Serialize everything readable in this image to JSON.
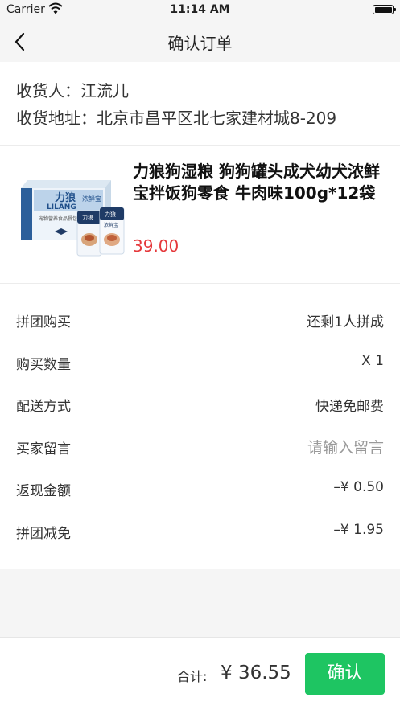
{
  "status_bar": {
    "carrier": "Carrier",
    "time": "11:14 AM"
  },
  "nav": {
    "title": "确认订单",
    "back_icon": "chevron-left-icon"
  },
  "address": {
    "receiver_label": "收货人：",
    "receiver_name": "江流儿",
    "address_label": "收货地址：",
    "address_value": "北京市昌平区北七家建材城8-209"
  },
  "product": {
    "name": "力狼狗湿粮 狗狗罐头成犬幼犬浓鲜宝拌饭狗零食 牛肉味100g*12袋",
    "price": "39.00",
    "image_box_brand": "力狼",
    "image_box_brand_en": "LILANG",
    "image_box_sub": "浓鲜宝",
    "image_box_line": "宠物营养食品餐包",
    "image_pouch_brand": "力狼",
    "image_pouch_sub": "浓鲜宝"
  },
  "rows": [
    {
      "label": "拼团购买",
      "value": "还剩1人拼成"
    },
    {
      "label": "购买数量",
      "value": "X 1"
    },
    {
      "label": "配送方式",
      "value": "快递免邮费"
    },
    {
      "label": "买家留言",
      "placeholder": "请输入留言"
    },
    {
      "label": "返现金额",
      "value": "–¥ 0.50"
    },
    {
      "label": "拼团减免",
      "value": "–¥ 1.95"
    }
  ],
  "bottom": {
    "total_label": "合计:",
    "total_value": "¥ 36.55",
    "confirm_label": "确认"
  },
  "colors": {
    "accent_green": "#1ec562",
    "price_red": "#e5383b",
    "bar_gray": "#f5f5f5"
  }
}
